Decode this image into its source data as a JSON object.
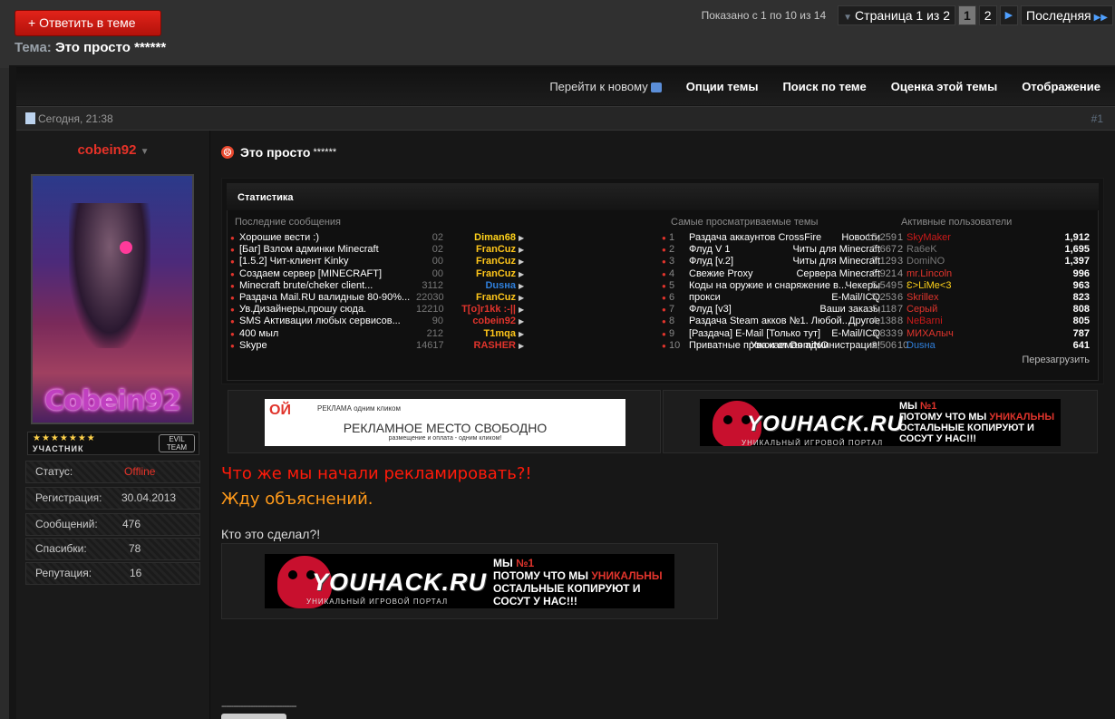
{
  "thread": {
    "reply_label": "Ответить в теме",
    "label": "Тема:",
    "title": "Это просто ******"
  },
  "pager": {
    "shown": "Показано с 1 по 10 из 14",
    "page_select": "Страница 1 из 2",
    "pages": [
      "1",
      "2"
    ],
    "last": "Последняя"
  },
  "toolbar": {
    "go_new": "Перейти к новому",
    "options": "Опции темы",
    "search": "Поиск по теме",
    "rate": "Оценка этой темы",
    "display": "Отображение"
  },
  "post": {
    "date": "Сегодня, 21:38",
    "number": "#1",
    "title": "Это просто",
    "title_stars": "******"
  },
  "user": {
    "name": "cobein92",
    "avatar_text": "Cobein92",
    "rank_label": "УЧАСТНИК",
    "team_badge": "EVIL TEAM",
    "info": [
      {
        "k": "Статус:",
        "v": "Offline"
      },
      {
        "k": "Регистрация:",
        "v": "30.04.2013"
      },
      {
        "k": "Сообщений:",
        "v": "476"
      },
      {
        "k": "Спасибки:",
        "v": "78"
      },
      {
        "k": "Репутация:",
        "v": "16"
      }
    ]
  },
  "stats": {
    "title": "Статистика",
    "col1_header": "Последние сообщения",
    "col2_header": "Самые просматриваемые темы",
    "col3_header": "Активные пользователи",
    "recent": [
      {
        "t": "Хорошие вести :)",
        "n": "02",
        "u": "Diman68",
        "uc": "#ffd21a",
        "cat": "Новости"
      },
      {
        "t": "[Баг] Взлом админки Minecraft",
        "n": "02",
        "u": "FranCuz",
        "uc": "#ffc61a",
        "cat": "Читы для Minecraft"
      },
      {
        "t": "[1.5.2] Чит-клиент Kinky",
        "n": "00",
        "u": "FranCuz",
        "uc": "#ffc61a",
        "cat": "Читы для Minecraft"
      },
      {
        "t": "Создаем сервер [MINECRAFT]",
        "n": "00",
        "u": "FranCuz",
        "uc": "#ffc61a",
        "cat": "Сервера Minecraft"
      },
      {
        "t": "Minecraft brute/cheker client...",
        "n": "3112",
        "u": "Dusна",
        "uc": "#2f7fdb",
        "cat": "Чекеры"
      },
      {
        "t": "Раздача Mail.RU валидные 80-90%...",
        "n": "22030",
        "u": "FranCuz",
        "uc": "#ffc61a",
        "cat": "E-Mail/ICQ"
      },
      {
        "t": "Ув.Дизайнеры,прошу сюда.",
        "n": "12210",
        "u": "T[o]r1kk :-||",
        "uc": "#e0342c",
        "cat": "Ваши заказы"
      },
      {
        "t": "SMS Активации любых сервисов...",
        "n": "90",
        "u": "cobein92",
        "uc": "#e0342c",
        "cat": "Другое"
      },
      {
        "t": "400 мыл",
        "n": "212",
        "u": "T1mqa",
        "uc": "#ffc61a",
        "cat": "E-Mail/ICQ"
      },
      {
        "t": "Skype",
        "n": "14617",
        "u": "RASHER",
        "uc": "#e0342c",
        "cat": "Уважаемая администрация!"
      }
    ],
    "popular": [
      {
        "i": "1",
        "t": "Раздача аккаунтов CrossFire",
        "n": "15,259"
      },
      {
        "i": "2",
        "t": "Флуд V 1",
        "n": "8,667"
      },
      {
        "i": "3",
        "t": "Флуд [v.2]",
        "n": "7,129"
      },
      {
        "i": "4",
        "t": "Свежие Proxy",
        "n": "6,921"
      },
      {
        "i": "5",
        "t": "Коды на оружие и снаряжение в...",
        "n": "5,549"
      },
      {
        "i": "6",
        "t": "прокси",
        "n": "5,253"
      },
      {
        "i": "7",
        "t": "Флуд [v3]",
        "n": "5,118"
      },
      {
        "i": "8",
        "t": "Раздача Steam акков №1. Любой...",
        "n": "4,138"
      },
      {
        "i": "9",
        "t": "[Раздача] E-Mail [Только тут]",
        "n": "3,833"
      },
      {
        "i": "10",
        "t": "Приватные прокси от DomiNO",
        "n": "3,506"
      }
    ],
    "active": [
      {
        "i": "1",
        "u": "SkyMaker",
        "uc": "#cc1a1a",
        "n": "1,912"
      },
      {
        "i": "2",
        "u": "Ra6eK",
        "uc": "#777777",
        "n": "1,695"
      },
      {
        "i": "3",
        "u": "DomiNO",
        "uc": "#777777",
        "n": "1,397"
      },
      {
        "i": "4",
        "u": "mr.Lincoln",
        "uc": "#e0342c",
        "n": "996"
      },
      {
        "i": "5",
        "u": "Ɛ>LiMe<3",
        "uc": "#ffd21a",
        "n": "963"
      },
      {
        "i": "6",
        "u": "Skrillex",
        "uc": "#e0342c",
        "n": "823"
      },
      {
        "i": "7",
        "u": "Серый",
        "uc": "#e0342c",
        "n": "808"
      },
      {
        "i": "8",
        "u": "NeBarni",
        "uc": "#cc1a1a",
        "n": "805"
      },
      {
        "i": "9",
        "u": "МИХАлыч",
        "uc": "#e0342c",
        "n": "787"
      },
      {
        "i": "10",
        "u": "Dusна",
        "uc": "#2f7fdb",
        "n": "641"
      }
    ],
    "reload": "Перезагрузить"
  },
  "ads": {
    "free_logo": "ОЙ",
    "free_logo_sub": "РЕКЛАМА одним кликом",
    "free_title": "РЕКЛАМНОЕ МЕСТО СВОБОДНО",
    "free_sub": "размещение и оплата - одним кликом!",
    "yh_name": "YOUHACK.RU",
    "yh_sub": "УНИКАЛЬНЫЙ ИГРОВОЙ ПОРТАЛ",
    "yh_line1a": "МЫ ",
    "yh_line1b": "№1",
    "yh_line2a": "ПОТОМУ ЧТО МЫ ",
    "yh_line2b": "УНИКАЛЬНЫ",
    "yh_line3": "ОСТАЛЬНЫЕ КОПИРУЮТ И",
    "yh_line4": "СОСУТ У НАС!!!"
  },
  "message": {
    "line1": "Что же мы начали рекламировать?!",
    "line2": "Жду объяснений.",
    "line3": "Кто это сделал?!",
    "sig_line": "-------------------------------"
  },
  "colors": {
    "accent_red": "#e0342c",
    "brand_orange": "#ff9a1a"
  }
}
